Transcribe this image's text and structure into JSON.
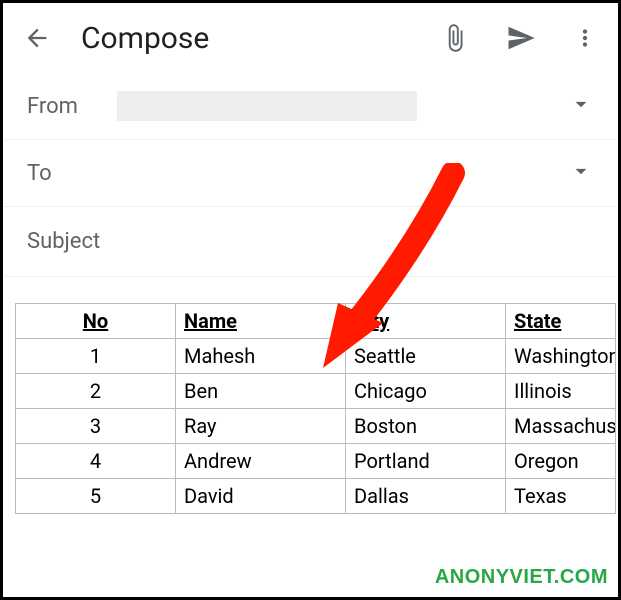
{
  "header": {
    "title": "Compose"
  },
  "fields": {
    "from_label": "From",
    "to_label": "To",
    "subject_label": "Subject"
  },
  "table": {
    "headers": {
      "no": "No",
      "name": "Name",
      "city": "City",
      "state": "State"
    },
    "rows": [
      {
        "no": "1",
        "name": "Mahesh",
        "city": "Seattle",
        "state": "Washington"
      },
      {
        "no": "2",
        "name": "Ben",
        "city": "Chicago",
        "state": "Illinois"
      },
      {
        "no": "3",
        "name": "Ray",
        "city": "Boston",
        "state": "Massachusetts"
      },
      {
        "no": "4",
        "name": "Andrew",
        "city": "Portland",
        "state": "Oregon"
      },
      {
        "no": "5",
        "name": "David",
        "city": "Dallas",
        "state": "Texas"
      }
    ]
  },
  "watermark": "ANONYVIET.COM"
}
